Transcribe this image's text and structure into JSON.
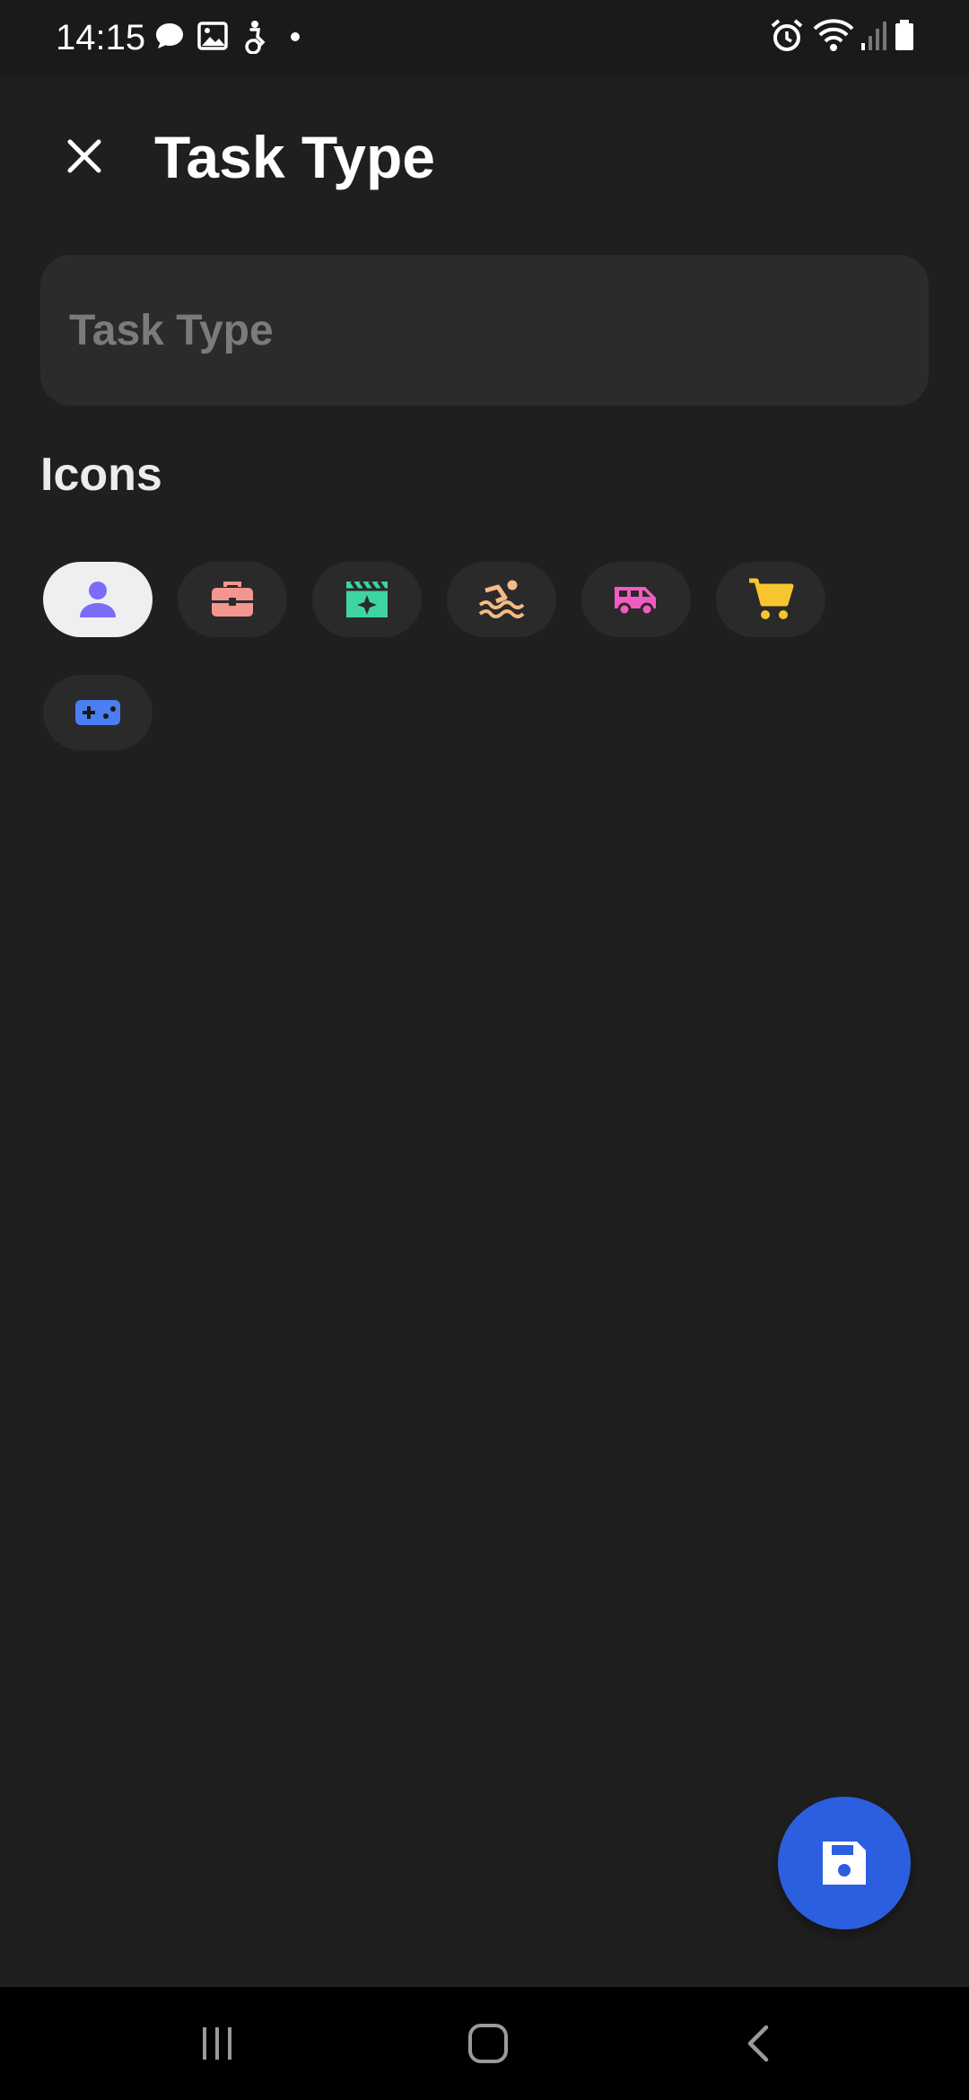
{
  "status_bar": {
    "time": "14:15",
    "left_icons": [
      "chat-bubble-icon",
      "image-icon",
      "accessibility-icon",
      "dot-icon"
    ],
    "right_icons": [
      "alarm-icon",
      "wifi-icon",
      "signal-icon",
      "battery-icon"
    ]
  },
  "header": {
    "title": "Task Type",
    "close_icon": "close-icon"
  },
  "form": {
    "task_type": {
      "value": "",
      "placeholder": "Task Type"
    }
  },
  "icons_section": {
    "label": "Icons",
    "items": [
      {
        "icon": "person-icon",
        "color": "#7b6cf6",
        "selected": true
      },
      {
        "icon": "briefcase-icon",
        "color": "#f2968f",
        "selected": false
      },
      {
        "icon": "movie-clapper-icon",
        "color": "#3fd4a4",
        "selected": false
      },
      {
        "icon": "swimming-icon",
        "color": "#f3bb85",
        "selected": false
      },
      {
        "icon": "van-icon",
        "color": "#f25cc0",
        "selected": false
      },
      {
        "icon": "shopping-cart-icon",
        "color": "#f7c62e",
        "selected": false
      },
      {
        "icon": "gamepad-icon",
        "color": "#4a7ef2",
        "selected": false
      }
    ]
  },
  "fab": {
    "icon": "save-icon",
    "color": "#2c5fdf"
  },
  "nav_bar": {
    "icons": [
      "recent-apps-icon",
      "home-icon",
      "back-icon"
    ]
  }
}
